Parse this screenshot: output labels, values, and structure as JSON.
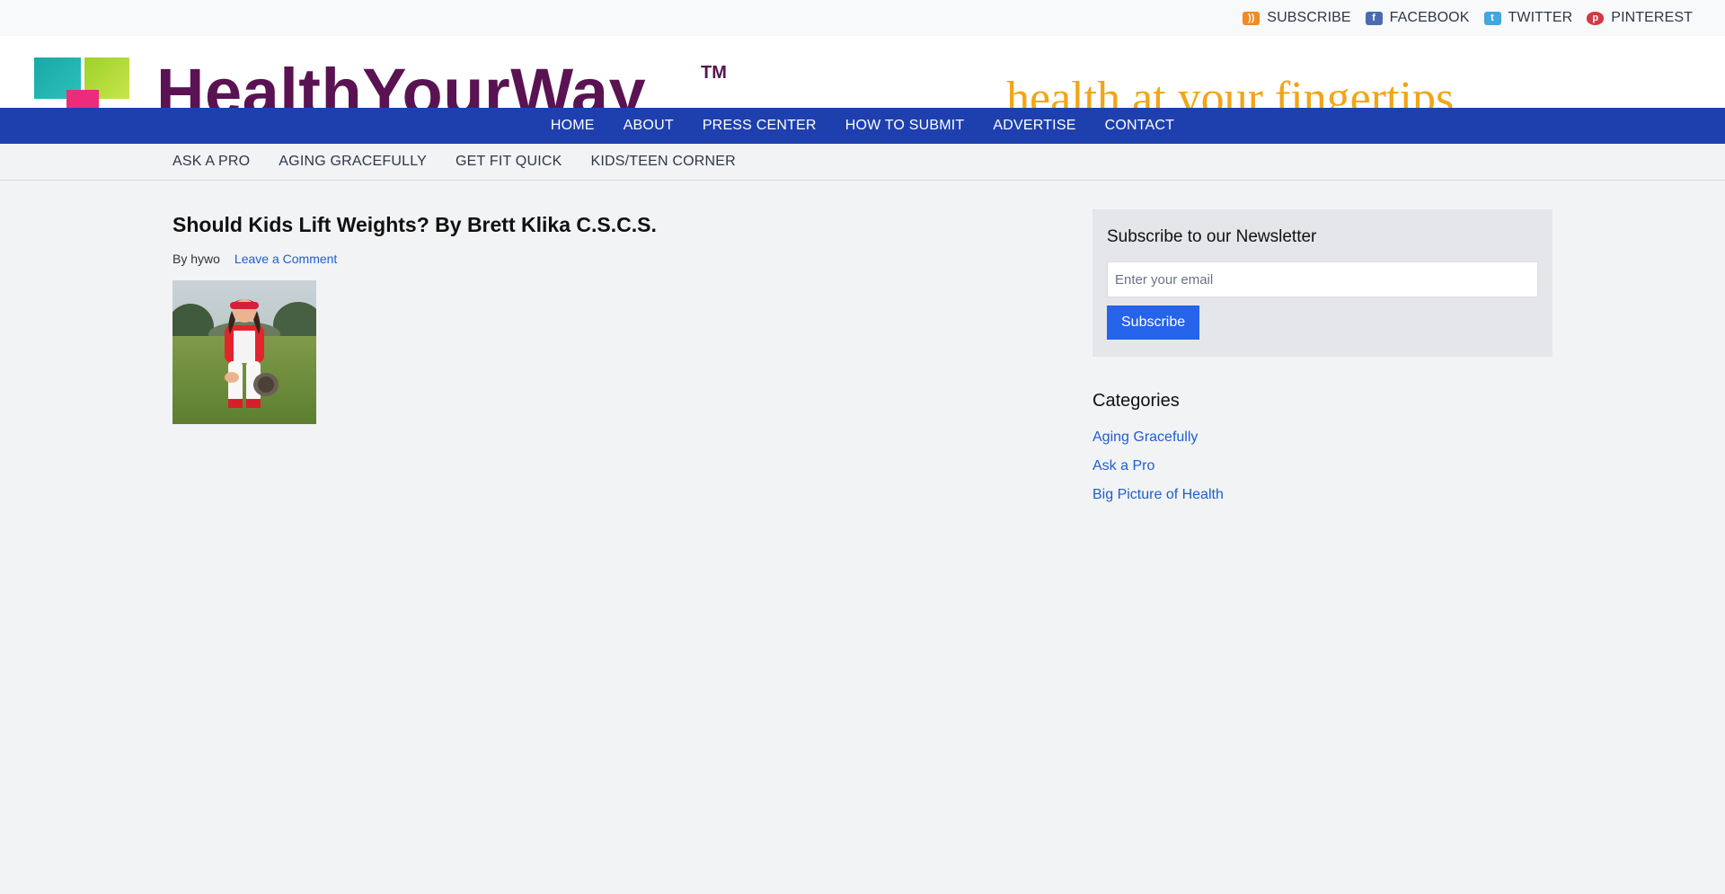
{
  "social": {
    "items": [
      {
        "label": "SUBSCRIBE",
        "icon": "rss-icon"
      },
      {
        "label": "FACEBOOK",
        "icon": "facebook-icon"
      },
      {
        "label": "TWITTER",
        "icon": "twitter-icon"
      },
      {
        "label": "PINTEREST",
        "icon": "pinterest-icon"
      }
    ]
  },
  "header": {
    "logo_text": "HealthYourWay",
    "trademark": "TM",
    "tagline": "health at your fingertips"
  },
  "main_nav": [
    "HOME",
    "ABOUT",
    "PRESS CENTER",
    "HOW TO SUBMIT",
    "ADVERTISE",
    "CONTACT"
  ],
  "sub_nav": [
    "ASK A PRO",
    "AGING GRACEFULLY",
    "GET FIT QUICK",
    "KIDS/TEEN CORNER"
  ],
  "article": {
    "title": "Should Kids Lift Weights? By Brett Klika C.S.C.S.",
    "byline": "By hywo",
    "comment_link": "Leave a Comment"
  },
  "sidebar": {
    "newsletter_title": "Subscribe to our Newsletter",
    "email_placeholder": "Enter your email",
    "subscribe_button": "Subscribe",
    "categories_title": "Categories",
    "categories": [
      "Aging Gracefully",
      "Ask a Pro",
      "Big Picture of Health"
    ]
  },
  "colors": {
    "nav_blue": "#1e40af",
    "link_blue": "#1d5fcf",
    "button_blue": "#2563eb",
    "logo_purple": "#5a1352",
    "tagline_orange": "#f2a516"
  }
}
